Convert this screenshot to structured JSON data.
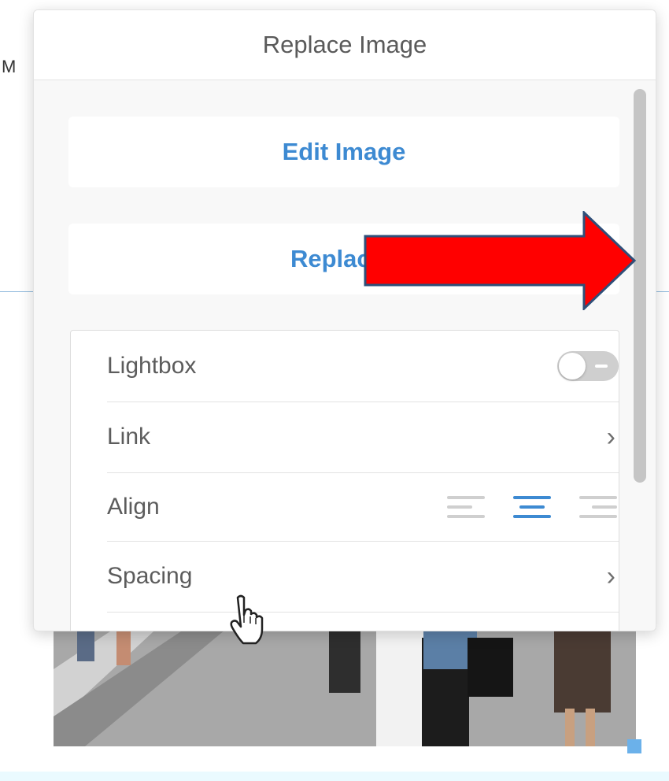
{
  "background": {
    "left_letter": "M",
    "right_letter": "."
  },
  "panel": {
    "title": "Replace Image",
    "edit_button": "Edit Image",
    "replace_button": "Replace I",
    "settings": {
      "lightbox": {
        "label": "Lightbox",
        "enabled": false
      },
      "link": {
        "label": "Link",
        "chevron": "chevron-right-icon"
      },
      "align": {
        "label": "Align",
        "options": [
          "align-left-icon",
          "align-center-icon",
          "align-right-icon"
        ],
        "selected": "center"
      },
      "spacing": {
        "label": "Spacing",
        "chevron": "chevron-right-icon"
      }
    }
  },
  "colors": {
    "accent": "#3d8ad2",
    "arrow_fill": "#ff0000",
    "arrow_stroke": "#2f4f79"
  }
}
